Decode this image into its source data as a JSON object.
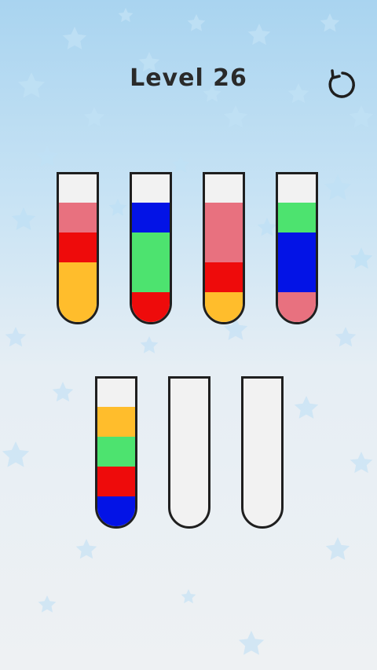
{
  "header": {
    "level_label": "Level 26",
    "restart_icon": "restart-icon"
  },
  "colors": {
    "pink": "#e8717f",
    "red": "#ee0b0b",
    "yellow": "#ffbd2c",
    "blue": "#0313e6",
    "green": "#4de36f",
    "empty": "#f2f2f2"
  },
  "tubes": [
    {
      "layers": [
        "yellow",
        "yellow",
        "red",
        "pink"
      ]
    },
    {
      "layers": [
        "red",
        "green",
        "green",
        "blue"
      ]
    },
    {
      "layers": [
        "yellow",
        "red",
        "pink",
        "pink"
      ]
    },
    {
      "layers": [
        "pink",
        "blue",
        "blue",
        "green"
      ]
    },
    {
      "layers": [
        "blue",
        "red",
        "green",
        "yellow"
      ]
    },
    {
      "layers": []
    },
    {
      "layers": []
    }
  ]
}
